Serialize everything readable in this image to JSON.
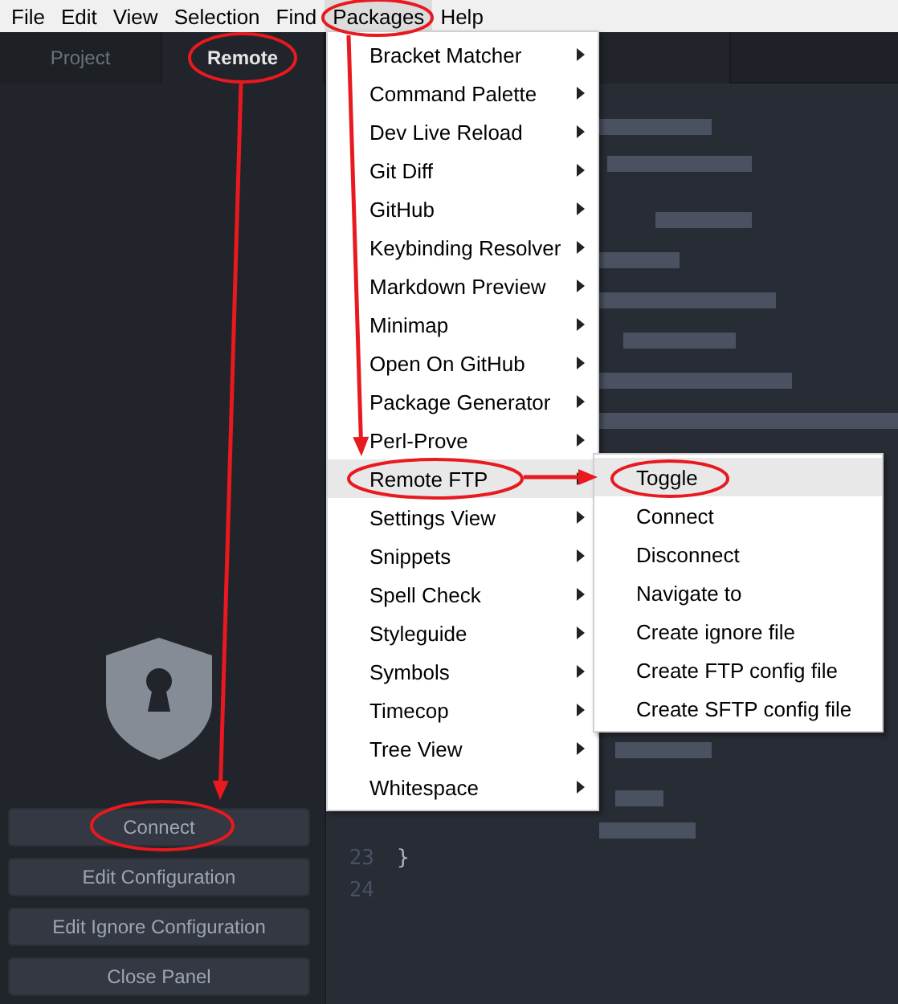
{
  "menubar": [
    {
      "label": "File",
      "selected": false
    },
    {
      "label": "Edit",
      "selected": false
    },
    {
      "label": "View",
      "selected": false
    },
    {
      "label": "Selection",
      "selected": false
    },
    {
      "label": "Find",
      "selected": false
    },
    {
      "label": "Packages",
      "selected": true
    },
    {
      "label": "Help",
      "selected": false
    }
  ],
  "side_panel": {
    "tabs": [
      {
        "label": "Project",
        "selected": false
      },
      {
        "label": "Remote",
        "selected": true
      }
    ],
    "buttons": [
      "Connect",
      "Edit Configuration",
      "Edit Ignore Configuration",
      "Close Panel"
    ]
  },
  "editor": {
    "lines": [
      {
        "number": "23",
        "text": "}"
      },
      {
        "number": "24"
      }
    ]
  },
  "packages_menu": {
    "items": [
      {
        "label": "Bracket Matcher",
        "selected": false
      },
      {
        "label": "Command Palette",
        "selected": false
      },
      {
        "label": "Dev Live Reload",
        "selected": false
      },
      {
        "label": "Git Diff",
        "selected": false
      },
      {
        "label": "GitHub",
        "selected": false
      },
      {
        "label": "Keybinding Resolver",
        "selected": false
      },
      {
        "label": "Markdown Preview",
        "selected": false
      },
      {
        "label": "Minimap",
        "selected": false
      },
      {
        "label": "Open On GitHub",
        "selected": false
      },
      {
        "label": "Package Generator",
        "selected": false
      },
      {
        "label": "Perl-Prove",
        "selected": false
      },
      {
        "label": "Remote FTP",
        "selected": true
      },
      {
        "label": "Settings View",
        "selected": false
      },
      {
        "label": "Snippets",
        "selected": false
      },
      {
        "label": "Spell Check",
        "selected": false
      },
      {
        "label": "Styleguide",
        "selected": false
      },
      {
        "label": "Symbols",
        "selected": false
      },
      {
        "label": "Timecop",
        "selected": false
      },
      {
        "label": "Tree View",
        "selected": false
      },
      {
        "label": "Whitespace",
        "selected": false
      }
    ]
  },
  "remote_ftp_menu": {
    "items": [
      {
        "label": "Toggle",
        "selected": true
      },
      {
        "label": "Connect",
        "selected": false
      },
      {
        "label": "Disconnect",
        "selected": false
      },
      {
        "label": "Navigate to",
        "selected": false
      },
      {
        "label": "Create ignore file",
        "selected": false
      },
      {
        "label": "Create FTP config file",
        "selected": false
      },
      {
        "label": "Create SFTP config file",
        "selected": false
      }
    ]
  }
}
